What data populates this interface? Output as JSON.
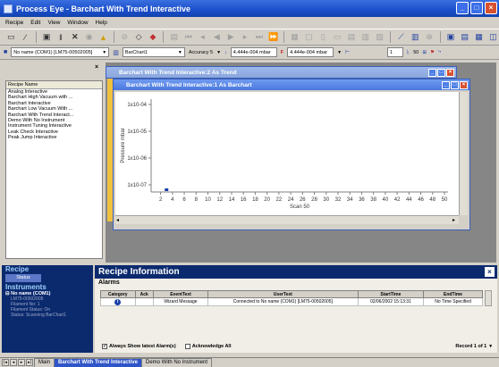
{
  "window": {
    "title": "Process Eye - Barchart With Trend Interactive"
  },
  "menu": [
    "Recipe",
    "Edit",
    "View",
    "Window",
    "Help"
  ],
  "toolbar_icons": [
    "new-icon",
    "wand-icon",
    "save-icon",
    "pause-icon",
    "delete-icon",
    "scan-icon",
    "alert-icon",
    "search-icon",
    "eraser-icon",
    "color-icon",
    "chart-icon",
    "first-icon",
    "prev-icon",
    "back-icon",
    "play-icon",
    "forward-icon",
    "next-icon",
    "last-icon",
    "grid-icon",
    "panel-a-icon",
    "panel-b-icon",
    "panel-c-icon",
    "panel-d-icon",
    "panel-e-icon",
    "panel-f-icon",
    "trend-icon",
    "bar-icon",
    "zoom-icon",
    "arrange-icon",
    "cascade-icon",
    "tile-icon",
    "save2-icon"
  ],
  "combobar": {
    "instrument": "No name (COM1) [LM75-00502005]",
    "chart": "BarChart1",
    "accuracy": "Accuracy 5",
    "range_low": "4.444e-004 mbar",
    "range_high": "4.444e-004 mbar",
    "scan": "1",
    "scan_sub": "50"
  },
  "recipe_panel": {
    "header": "Recipe Name",
    "items": [
      "Analog Interactive",
      "Barchart High Vacuum with ...",
      "Barchart Interactive",
      "Barchart Low Vacuum With ...",
      "Barchart With Trend Interact...",
      "Demo With No Instrument",
      "Instrument Tuning Interactive",
      "Leak Check Interactive",
      "Peak Jump Interactive"
    ]
  },
  "windows": {
    "back_title": "Barchart With Trend Interactive:2 As Trend",
    "front_title": "Barchart With Trend Interactive:1 As Barchart"
  },
  "chart_data": {
    "type": "bar",
    "ylabel": "Pressure mbar",
    "xlabel": "Scan 50",
    "yticks": [
      "1x10-04",
      "1x10-05",
      "1x10-06",
      "1x10-07"
    ],
    "xticks": [
      "2",
      "4",
      "6",
      "8",
      "10",
      "12",
      "14",
      "16",
      "18",
      "20",
      "22",
      "24",
      "26",
      "28",
      "30",
      "32",
      "34",
      "36",
      "38",
      "40",
      "42",
      "44",
      "46",
      "48",
      "50"
    ],
    "xlim": [
      1,
      50
    ],
    "markers": [
      {
        "x": 3
      }
    ]
  },
  "nav": {
    "recipe_title": "Recipe",
    "recipe_sub": "Status",
    "instruments_title": "Instruments",
    "instrument_name": "No name (COM1)",
    "details": [
      "LM75-00502005",
      "Filament No: 1",
      "Filament Status: On",
      "Status: Scanning BarChart1"
    ]
  },
  "info": {
    "title": "Recipe Information",
    "alarms_label": "Alarms",
    "columns": [
      "Category",
      "Ack",
      "EventText",
      "UserText",
      "StartTime",
      "EndTime"
    ],
    "rows": [
      {
        "category": "i",
        "ack": "",
        "event": "Wizard Message",
        "user": "Connected to No name (COM1) [LM75-00502005]",
        "start": "02/06/2002 15:13:31",
        "end": "No Time Specified"
      }
    ],
    "show_latest": "Always Show latest Alarm(s)",
    "ack_all": "Acknowledge All",
    "record": "Record 1 of 1"
  },
  "tabs": [
    "Main",
    "Barchart With Trend Interactive",
    "Demo With No Instrument"
  ]
}
